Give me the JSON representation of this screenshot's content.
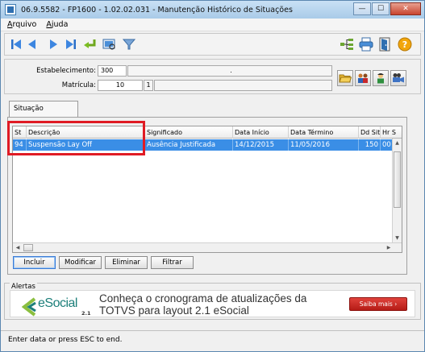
{
  "window": {
    "title": "06.9.5582 - FP1600 - 1.02.02.031 - Manutenção Histórico de Situações",
    "minimize_glyph": "—",
    "maximize_glyph": "☐",
    "close_glyph": "✕"
  },
  "menu": {
    "items": [
      "Arquivo",
      "Ajuda"
    ]
  },
  "toolbar": {
    "left_icons": [
      "first-record-icon",
      "previous-record-icon",
      "next-record-icon",
      "last-record-icon",
      "go-to-icon",
      "search-icon",
      "filter-icon"
    ],
    "right_icons": [
      "tree-view-icon",
      "print-icon",
      "exit-icon",
      "help-icon"
    ],
    "help_glyph": "?"
  },
  "form": {
    "estabelecimento_label": "Estabelecimento:",
    "estabelecimento_value": "300",
    "estabelecimento_desc": ".",
    "matricula_label": "Matrícula:",
    "matricula_value": "10",
    "matricula_digit": "1"
  },
  "tabs": [
    {
      "label": "Situação"
    }
  ],
  "grid": {
    "columns": [
      "St",
      "Descrição",
      "Significado",
      "Data Início",
      "Data Término",
      "Dd Sit",
      "Hr S"
    ],
    "rows": [
      {
        "st": "94",
        "descricao": "Suspensão Lay Off",
        "significado": "Ausência Justificada",
        "data_inicio": "14/12/2015",
        "data_termino": "11/05/2016",
        "dd_sit": "150",
        "hr_s": "00"
      }
    ]
  },
  "buttons": {
    "incluir": "Incluir",
    "modificar": "Modificar",
    "eliminar": "Eliminar",
    "filtrar": "Filtrar"
  },
  "alerts": {
    "label": "Alertas",
    "brand": "eSocial",
    "brand_version": "2.1",
    "message_line1": "Conheça o cronograma de atualizações da",
    "message_line2": "TOTVS para layout 2.1 eSocial",
    "cta": "Saiba mais ›"
  },
  "status": {
    "text": "Enter data or press ESC to end."
  },
  "colors": {
    "selection": "#3a8ee6",
    "highlight_border": "#e01b24",
    "cta": "#c9231d",
    "brand": "#1d7f7a"
  }
}
